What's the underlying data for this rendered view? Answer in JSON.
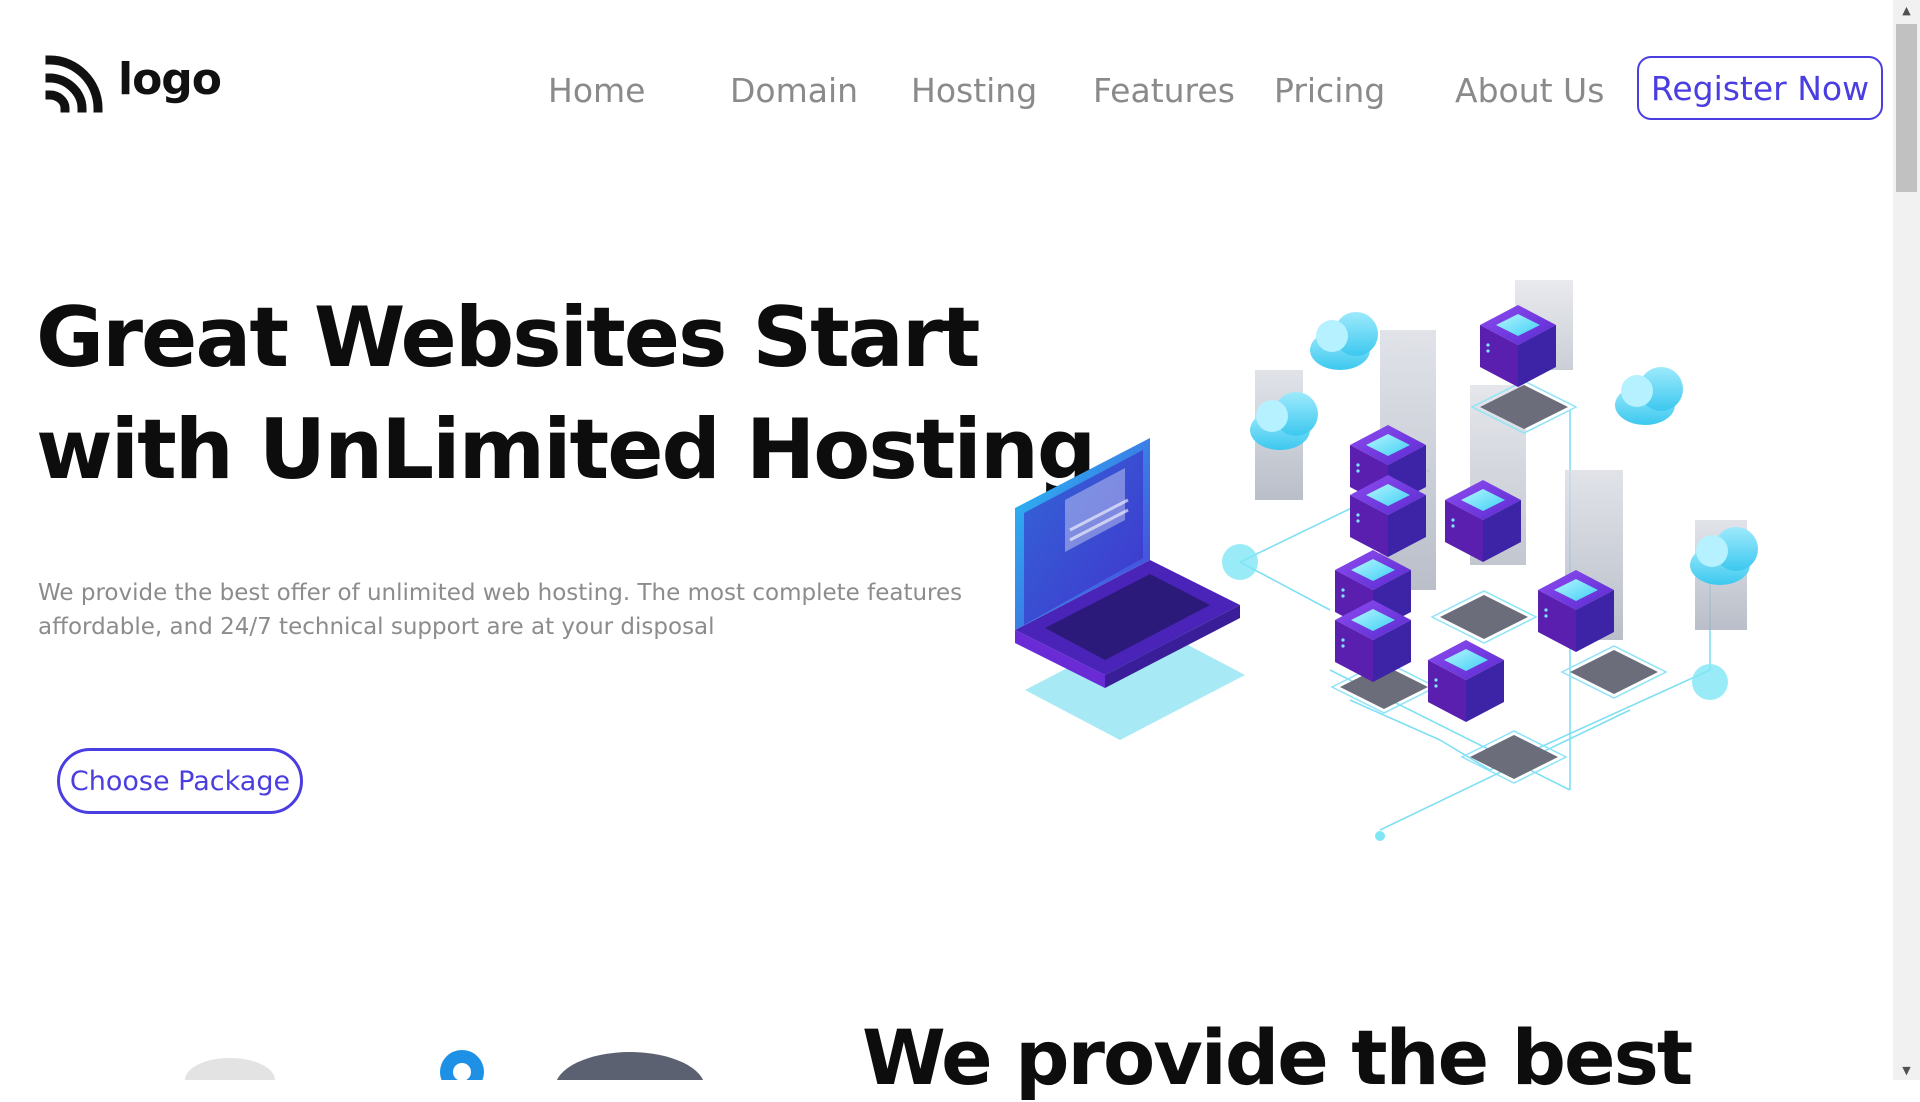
{
  "brand": {
    "logo_text": "logo",
    "accent_color": "#4b3ee0"
  },
  "nav": {
    "items": [
      {
        "label": "Home"
      },
      {
        "label": "Domain"
      },
      {
        "label": "Hosting"
      },
      {
        "label": "Features"
      },
      {
        "label": "Pricing"
      },
      {
        "label": "About Us"
      }
    ],
    "register_label": "Register Now"
  },
  "hero": {
    "title_line1": "Great Websites Start",
    "title_line2": "with UnLimited Hosting",
    "description_line1": "We provide the best offer of unlimited web hosting. The most complete features",
    "description_line2": "affordable, and 24/7 technical support are at your disposal",
    "cta_label": "Choose Package",
    "illustration": "isometric-servers-laptop-illustration"
  },
  "section2": {
    "title": "We provide the best"
  },
  "scrollbar": {
    "up_icon": "▲",
    "down_icon": "▼"
  }
}
